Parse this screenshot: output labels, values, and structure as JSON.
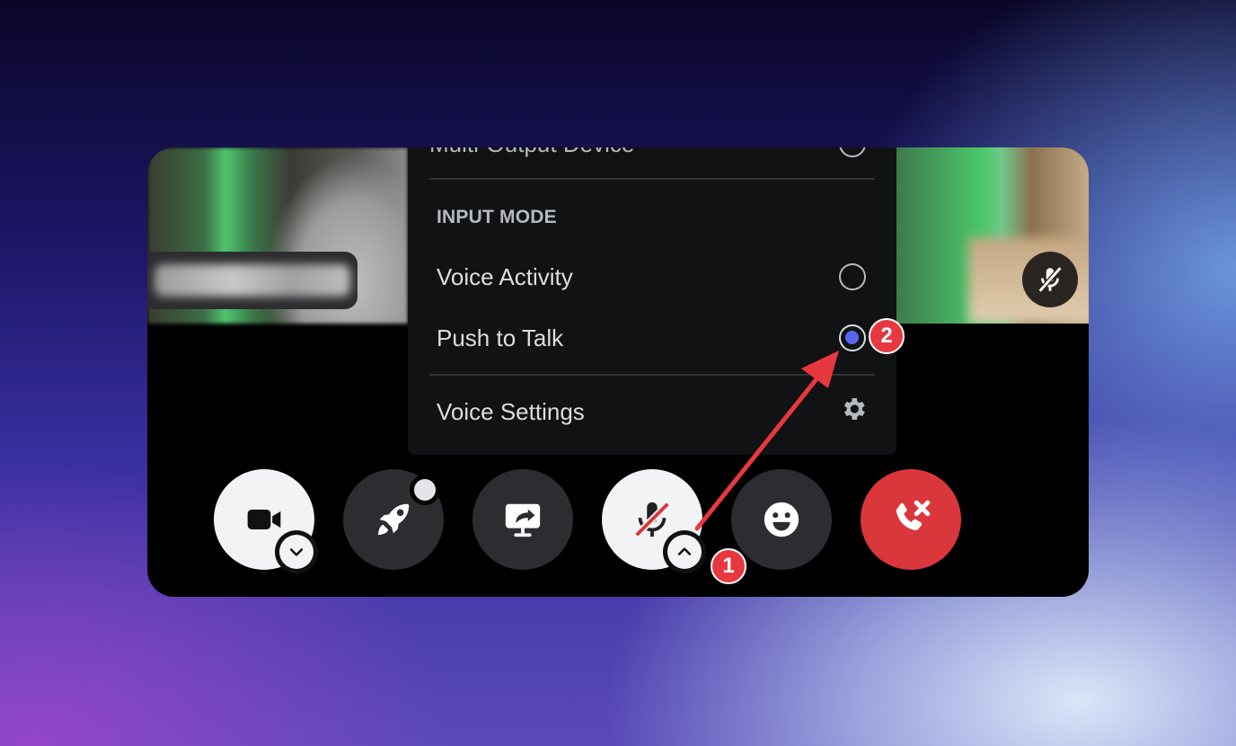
{
  "menu": {
    "partial_item_label": "Multi-Output Device",
    "section_title": "INPUT MODE",
    "options": [
      {
        "label": "Voice Activity",
        "selected": false
      },
      {
        "label": "Push to Talk",
        "selected": true
      }
    ],
    "settings_label": "Voice Settings",
    "accent_color": "#5865f2"
  },
  "controls": {
    "camera_icon": "video-camera-icon",
    "activity_icon": "rocket-icon",
    "share_icon": "screen-share-icon",
    "mic_icon": "microphone-muted-icon",
    "emoji_icon": "smile-icon",
    "hangup_icon": "phone-hangup-icon",
    "hangup_color": "#da373c"
  },
  "annotations": {
    "step1": "1",
    "step2": "2",
    "color": "#e8383f"
  }
}
